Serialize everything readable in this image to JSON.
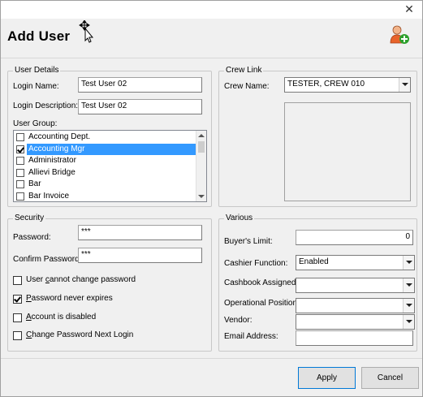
{
  "window": {
    "title": "Add User",
    "close_glyph": "✕"
  },
  "icons": {
    "close": "close-icon",
    "move_cursor": "move-cursor-icon",
    "user_add": "user-add-icon"
  },
  "user_details": {
    "legend": "User Details",
    "login_name_label": "Login Name:",
    "login_name_value": "Test User 02",
    "login_desc_label": "Login Description:",
    "login_desc_value": "Test User 02",
    "user_group_label": "User Group:",
    "user_groups": [
      {
        "label": "Accounting Dept.",
        "checked": false,
        "selected": false
      },
      {
        "label": "Accounting Mgr",
        "checked": true,
        "selected": true
      },
      {
        "label": "Administrator",
        "checked": false,
        "selected": false
      },
      {
        "label": "Allievi Bridge",
        "checked": false,
        "selected": false
      },
      {
        "label": "Bar",
        "checked": false,
        "selected": false
      },
      {
        "label": "Bar Invoice",
        "checked": false,
        "selected": false
      }
    ]
  },
  "crew_link": {
    "legend": "Crew Link",
    "crew_name_label": "Crew Name:",
    "crew_name_value": "TESTER, CREW 010"
  },
  "security": {
    "legend": "Security",
    "password_label": "Password:",
    "password_value": "***",
    "confirm_label": "Confirm Password:",
    "confirm_value": "***",
    "options": [
      {
        "pre": "User ",
        "ul": "c",
        "post": "annot change password",
        "checked": false
      },
      {
        "pre": "",
        "ul": "P",
        "post": "assword never expires",
        "checked": true
      },
      {
        "pre": "",
        "ul": "A",
        "post": "ccount is disabled",
        "checked": false
      },
      {
        "pre": "",
        "ul": "C",
        "post": "hange Password Next Login",
        "checked": false
      }
    ]
  },
  "various": {
    "legend": "Various",
    "buyers_limit_label": "Buyer's Limit:",
    "buyers_limit_value": "0",
    "cashier_label": "Cashier Function:",
    "cashier_value": "Enabled",
    "cashbook_label": "Cashbook Assigned:",
    "cashbook_value": "",
    "op_position_label": "Operational Position:",
    "op_position_value": "",
    "vendor_label": "Vendor:",
    "vendor_value": "",
    "email_label": "Email Address:",
    "email_value": ""
  },
  "buttons": {
    "apply": "Apply",
    "cancel": "Cancel"
  }
}
